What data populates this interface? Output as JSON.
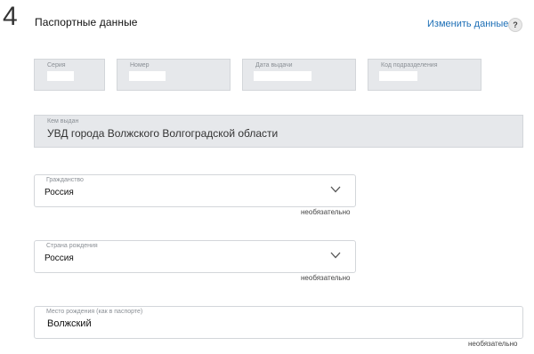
{
  "section": {
    "number": "4",
    "title": "Паспортные данные",
    "edit_link": "Изменить данные",
    "help": "?"
  },
  "passport": {
    "series_label": "Серия",
    "number_label": "Номер",
    "issue_date_label": "Дата выдачи",
    "division_code_label": "Код подразделения",
    "issued_by_label": "Кем выдан",
    "issued_by_value": "УВД города Волжского Волгоградской области"
  },
  "citizenship": {
    "label": "Гражданство",
    "value": "Россия",
    "optional": "необязательно"
  },
  "birth_country": {
    "label": "Страна рождения",
    "value": "Россия",
    "optional": "необязательно"
  },
  "birth_place": {
    "label": "Место рождения (как в паспорте)",
    "value": "Волжский",
    "optional": "необязательно"
  },
  "colors": {
    "link": "#1d6fb6",
    "readonly_bg": "#e6e8eb",
    "border": "#d3d6da"
  }
}
